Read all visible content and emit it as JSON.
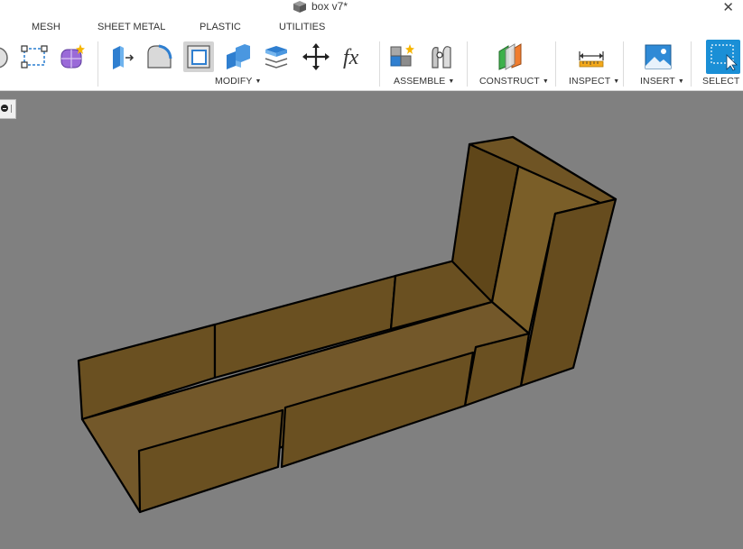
{
  "window": {
    "title": "box v7*",
    "doc_icon": "box-icon",
    "close_glyph": "✕"
  },
  "tabs": [
    "MESH",
    "SHEET METAL",
    "PLASTIC",
    "UTILITIES"
  ],
  "toolbar": {
    "groups": {
      "modify": "MODIFY",
      "assemble": "ASSEMBLE",
      "construct": "CONSTRUCT",
      "inspect": "INSPECT",
      "insert": "INSERT",
      "select": "SELECT"
    },
    "caret": "▼",
    "fx_label": "fx"
  },
  "colors": {
    "toolbar_bg": "#ffffff",
    "viewport_bg": "#808080",
    "model_face": "#6b5222",
    "model_top": "#7a5e28",
    "model_edge": "#000000",
    "select_blue": "#1a8fd6"
  }
}
